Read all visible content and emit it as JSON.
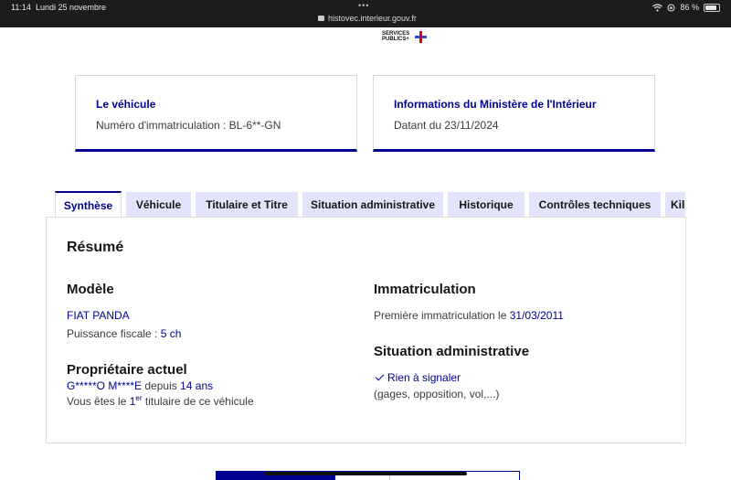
{
  "status_bar": {
    "time": "11:14",
    "date": "Lundi 25 novembre",
    "url": "histovec.interieur.gouv.fr",
    "battery": "86 %",
    "battery_level": 0.86,
    "dots": "•••"
  },
  "logo": {
    "line1": "SERVICES",
    "line2": "PUBLICS+"
  },
  "cards": [
    {
      "title": "Le véhicule",
      "text": "Numéro d'immatriculation : BL-6**-GN"
    },
    {
      "title": "Informations du Ministère de l'Intérieur",
      "text": "Datant du 23/11/2024"
    }
  ],
  "tabs": [
    "Synthèse",
    "Véhicule",
    "Titulaire et Titre",
    "Situation administrative",
    "Historique",
    "Contrôles techniques",
    "Kilométrage"
  ],
  "summary": {
    "title": "Résumé",
    "modele": {
      "heading": "Modèle",
      "name": "FIAT PANDA",
      "puissance_label": "Puissance fiscale :",
      "puissance_value": "5 ch"
    },
    "proprietaire": {
      "heading": "Propriétaire actuel",
      "name": "G*****O M****E",
      "depuis_label": "depuis",
      "depuis_value": "14 ans",
      "line2_prefix": "Vous êtes le",
      "rank": "1",
      "rank_suffix": "er",
      "line2_suffix": "titulaire de ce véhicule"
    },
    "immatriculation": {
      "heading": "Immatriculation",
      "label": "Première immatriculation le",
      "date": "31/03/2011"
    },
    "situation": {
      "heading": "Situation administrative",
      "status": "Rien à signaler",
      "detail": "(gages, opposition, vol,...)"
    }
  },
  "colors": {
    "accent": "#000091",
    "tab_bg": "#e3e3fd",
    "text": "#3a3a3a"
  }
}
